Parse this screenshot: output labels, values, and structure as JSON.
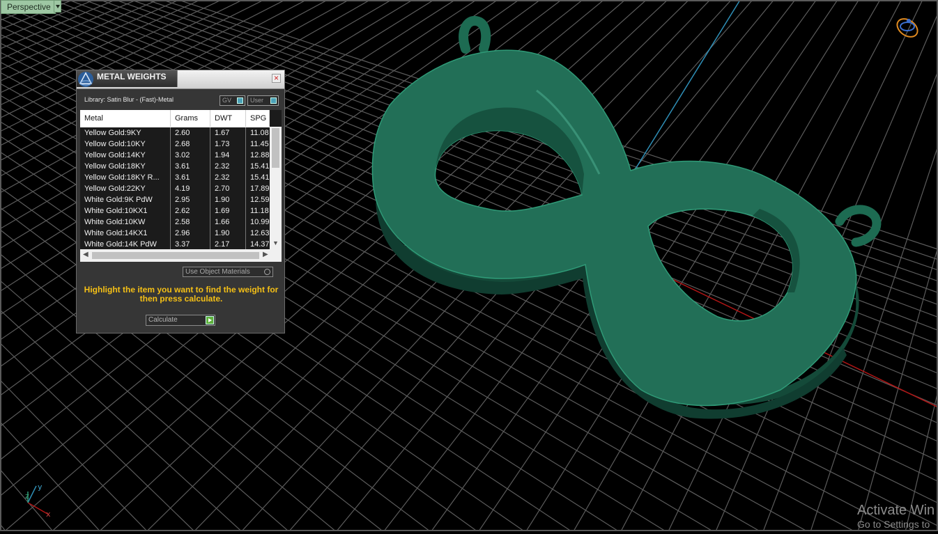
{
  "viewport": {
    "view_label": "Perspective",
    "axis_labels": {
      "x": "x",
      "y": "y",
      "z": "z"
    },
    "watermark": {
      "line1": "Activate Win",
      "line2": "Go to Settings to"
    }
  },
  "dialog": {
    "title": "METAL WEIGHTS",
    "close_glyph": "×",
    "library": "Library: Satin Blur - (Fast)-Metal",
    "gv_label": "GV",
    "user_label": "User",
    "columns": [
      "Metal",
      "Grams",
      "DWT",
      "SPG"
    ],
    "rows": [
      [
        "Yellow Gold:9KY",
        "2.60",
        "1.67",
        "11.08"
      ],
      [
        "Yellow Gold:10KY",
        "2.68",
        "1.73",
        "11.45"
      ],
      [
        "Yellow Gold:14KY",
        "3.02",
        "1.94",
        "12.88"
      ],
      [
        "Yellow Gold:18KY",
        "3.61",
        "2.32",
        "15.41"
      ],
      [
        "Yellow Gold:18KY R...",
        "3.61",
        "2.32",
        "15.41"
      ],
      [
        "Yellow Gold:22KY",
        "4.19",
        "2.70",
        "17.89"
      ],
      [
        "White Gold:9K PdW",
        "2.95",
        "1.90",
        "12.59"
      ],
      [
        "White Gold:10KX1",
        "2.62",
        "1.69",
        "11.18"
      ],
      [
        "White Gold:10KW",
        "2.58",
        "1.66",
        "10.99"
      ],
      [
        "White Gold:14KX1",
        "2.96",
        "1.90",
        "12.63"
      ],
      [
        "White Gold:14K PdW",
        "3.37",
        "2.17",
        "14.37"
      ]
    ],
    "use_object_materials_label": "Use Object Materials",
    "hint": "Highlight the item you want to find the weight for then press calculate.",
    "calculate_label": "Calculate"
  },
  "colors": {
    "model": "#1f6f55",
    "grid_line": "#5c5c5c",
    "hint_text": "#f5c016",
    "axis_red": "#b01515",
    "axis_blue": "#2f8fb7"
  }
}
